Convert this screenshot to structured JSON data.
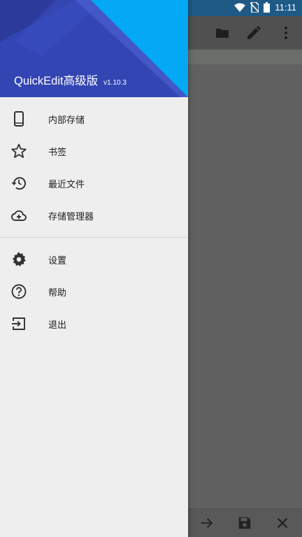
{
  "status_bar": {
    "time": "11:11"
  },
  "drawer": {
    "app_name": "QuickEdit高级版",
    "version": "v1.10.3",
    "primary_items": [
      {
        "label": "内部存储",
        "icon": "phone-icon"
      },
      {
        "label": "书签",
        "icon": "star-icon"
      },
      {
        "label": "最近文件",
        "icon": "history-icon"
      },
      {
        "label": "存储管理器",
        "icon": "cloud-add-icon"
      }
    ],
    "secondary_items": [
      {
        "label": "设置",
        "icon": "gear-icon"
      },
      {
        "label": "帮助",
        "icon": "help-icon"
      },
      {
        "label": "退出",
        "icon": "exit-icon"
      }
    ]
  },
  "background_toolbar": {
    "icons": [
      "folder-icon",
      "edit-icon",
      "more-vert-icon"
    ]
  },
  "background_bottom_bar": {
    "icons": [
      "arrow-right-icon",
      "save-icon",
      "close-icon"
    ]
  },
  "colors": {
    "header_dark": "#3345b3",
    "header_light": "#03a9f4",
    "drawer_bg": "#eeeeee",
    "scrim": "#616161"
  }
}
